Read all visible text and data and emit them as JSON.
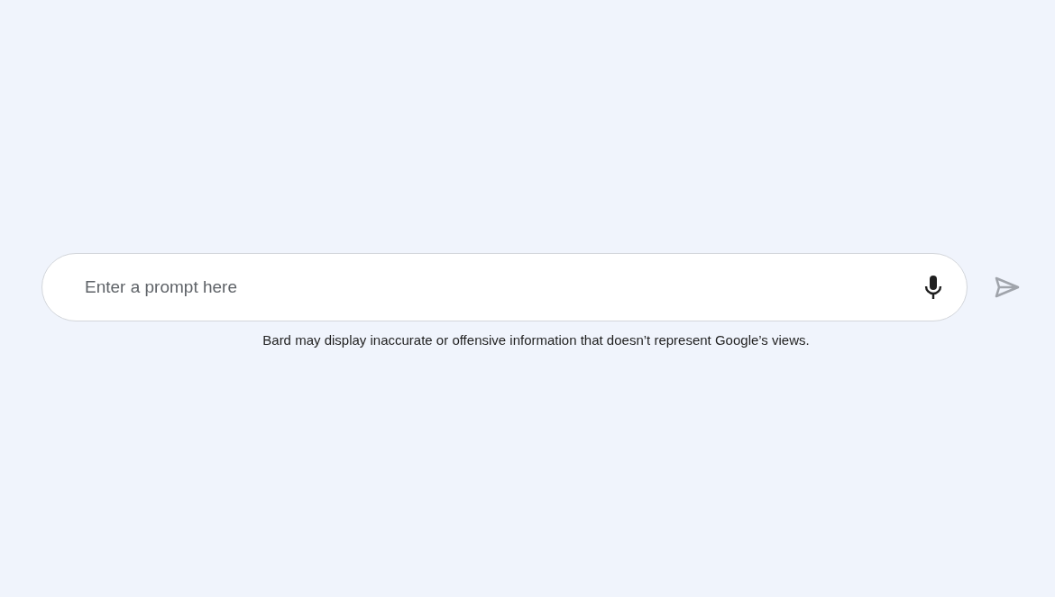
{
  "prompt_field": {
    "placeholder": "Enter a prompt here"
  },
  "send_button": {
    "disabled": true
  },
  "disclaimer": "Bard may display inaccurate or offensive information that doesn’t represent Google’s views."
}
